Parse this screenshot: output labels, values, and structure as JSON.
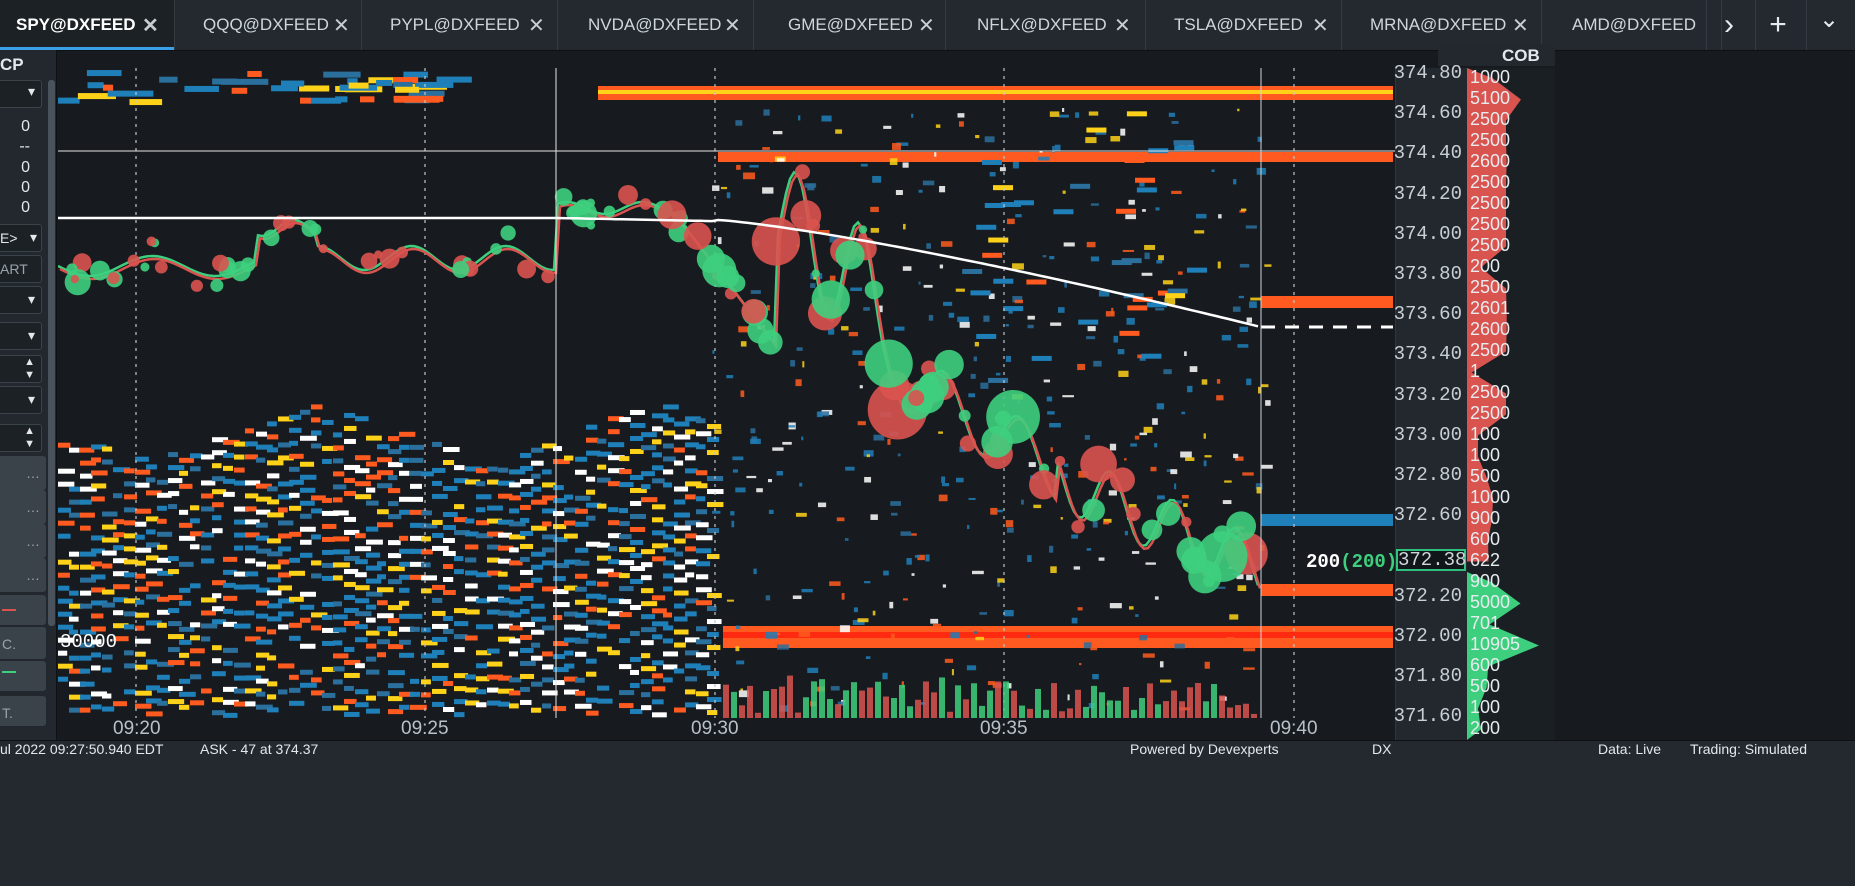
{
  "tabs": [
    {
      "label": "SPY@DXFEED",
      "active": true
    },
    {
      "label": "QQQ@DXFEED",
      "active": false
    },
    {
      "label": "PYPL@DXFEED",
      "active": false
    },
    {
      "label": "NVDA@DXFEED",
      "active": false
    },
    {
      "label": "GME@DXFEED",
      "active": false
    },
    {
      "label": "NFLX@DXFEED",
      "active": false
    },
    {
      "label": "TSLA@DXFEED",
      "active": false
    },
    {
      "label": "MRNA@DXFEED",
      "active": false
    },
    {
      "label": "AMD@DXFEED",
      "active": false
    }
  ],
  "tab_close_glyph": "✕",
  "tab_actions": {
    "next": "›",
    "add": "+",
    "menu": "⌄"
  },
  "left_panel": {
    "header": "CP",
    "values": [
      "0",
      "--",
      "0",
      "0",
      "0"
    ],
    "dropdown_labels": [
      "E>",
      "ART"
    ],
    "button_glyphs": [
      "…",
      "…",
      "…",
      "…"
    ],
    "partial_labels": [
      "C.",
      "T."
    ]
  },
  "chart": {
    "overlay_label": "30000",
    "cursor_size_label": "200",
    "cursor_size_paren": "(200)",
    "current_price": "372.38",
    "colors": {
      "buy": "#3ecf7e",
      "sell": "#d9534f",
      "heat_hot": "#ff5a1f",
      "heat_mid": "#ffd21a",
      "heat_cool": "#1f7fb8",
      "vwap": "#ffffff"
    }
  },
  "price_axis": {
    "labels": [
      "374.80",
      "374.60",
      "374.40",
      "374.20",
      "374.00",
      "373.80",
      "373.60",
      "373.40",
      "373.20",
      "373.00",
      "372.80",
      "372.60",
      "372.38",
      "372.20",
      "372.00",
      "371.80",
      "371.60"
    ]
  },
  "time_axis": {
    "labels": [
      "09:20",
      "09:25",
      "09:30",
      "09:35",
      "09:40"
    ]
  },
  "cob": {
    "header": "COB",
    "quantities": [
      "1000",
      "5100",
      "2500",
      "2500",
      "2600",
      "2500",
      "2500",
      "2500",
      "2500",
      "200",
      "2500",
      "2601",
      "2600",
      "2500",
      "1",
      "2500",
      "2500",
      "100",
      "100",
      "500",
      "1000",
      "900",
      "600",
      "622",
      "900",
      "5000",
      "701",
      "10905",
      "600",
      "500",
      "100",
      "200"
    ]
  },
  "status": {
    "datetime": "ul 2022 09:27:50.940 EDT",
    "ask": "ASK - 47 at 374.37",
    "powered": "Powered by Devexperts",
    "dx": "DX",
    "data": "Data: Live",
    "trading": "Trading: Simulated"
  }
}
